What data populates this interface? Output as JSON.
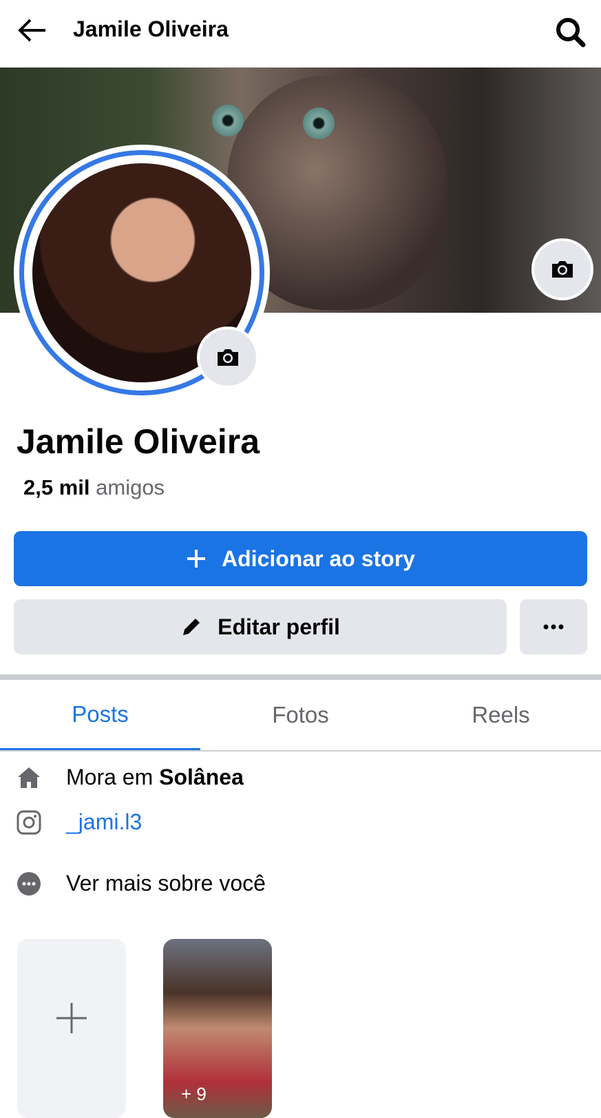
{
  "header": {
    "title": "Jamile Oliveira"
  },
  "profile": {
    "name": "Jamile Oliveira",
    "friends_count": "2,5 mil",
    "friends_label": "amigos"
  },
  "actions": {
    "add_story": "Adicionar ao story",
    "edit_profile": "Editar perfil"
  },
  "tabs": [
    {
      "label": "Posts"
    },
    {
      "label": "Fotos"
    },
    {
      "label": "Reels"
    }
  ],
  "info": {
    "lives_prefix": "Mora em",
    "lives_city": "Solânea",
    "instagram": "_jami.l3",
    "see_more": "Ver mais sobre você"
  },
  "stories": {
    "more_count": "+ 9"
  },
  "colors": {
    "accent": "#1b74e4",
    "button_grey": "#e4e6eb"
  }
}
